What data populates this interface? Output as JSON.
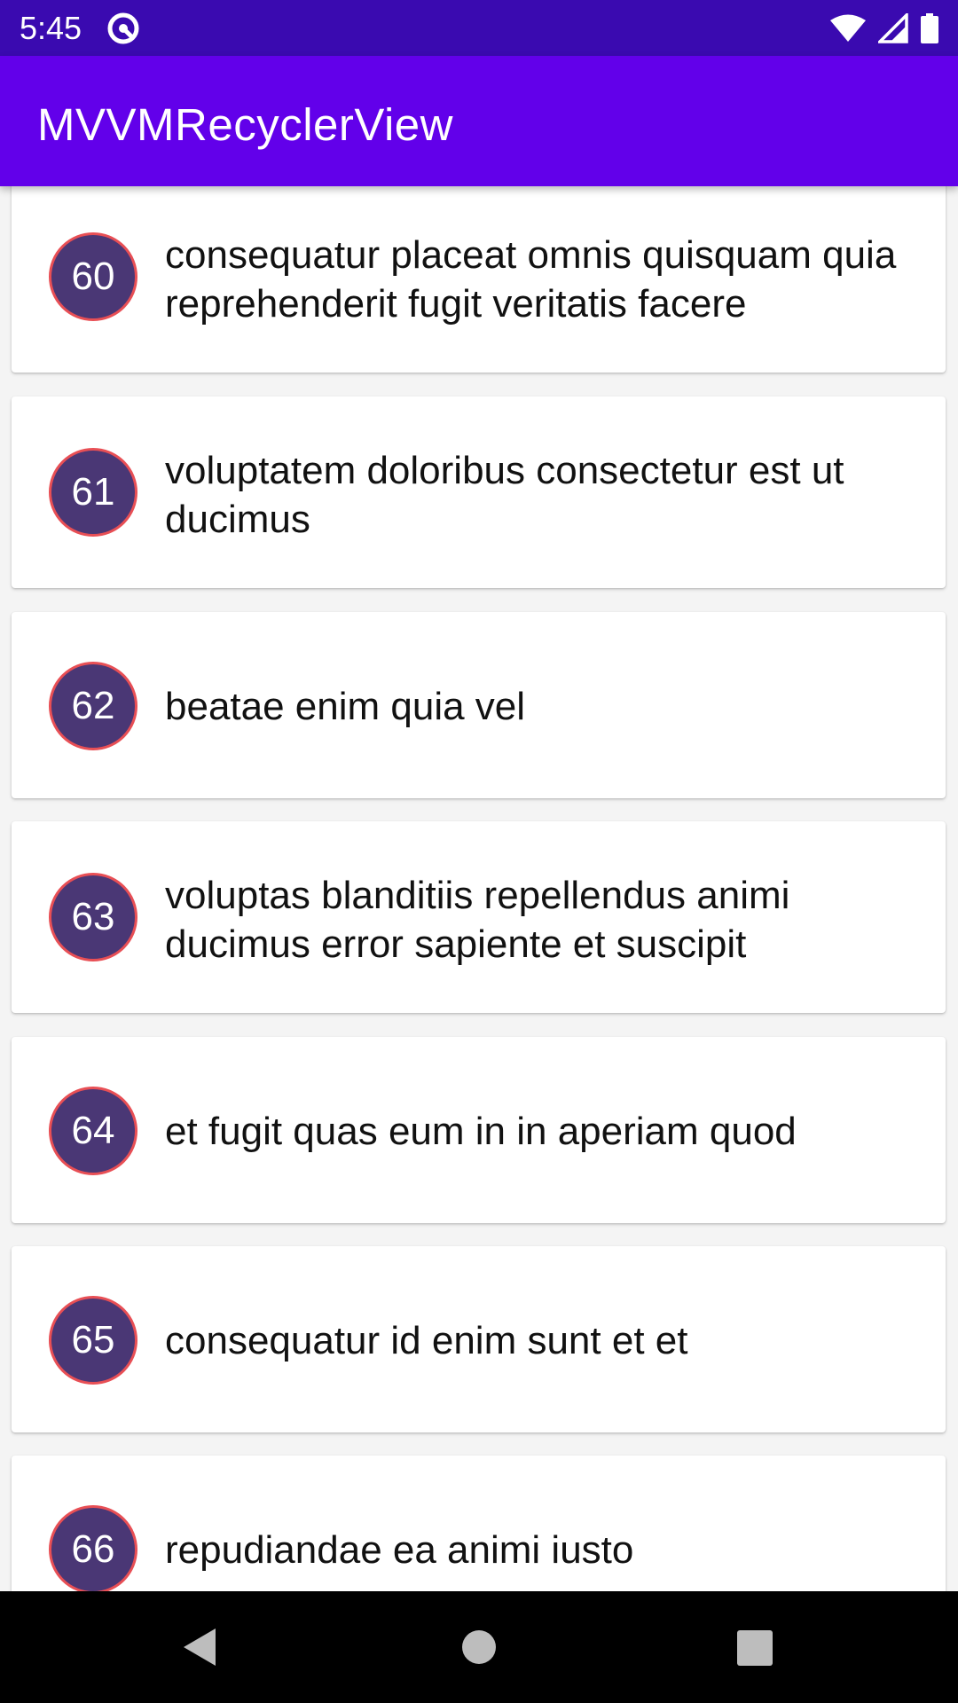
{
  "status_bar": {
    "time": "5:45",
    "icons": [
      "privacy-icon",
      "wifi-icon",
      "signal-icon",
      "battery-icon"
    ]
  },
  "app_bar": {
    "title": "MVVMRecyclerView"
  },
  "list": {
    "items": [
      {
        "id": "60",
        "text": "consequatur placeat omnis quisquam quia reprehenderit fugit veritatis facere"
      },
      {
        "id": "61",
        "text": "voluptatem doloribus consectetur est ut ducimus"
      },
      {
        "id": "62",
        "text": "beatae enim quia vel"
      },
      {
        "id": "63",
        "text": "voluptas blanditiis repellendus animi ducimus error sapiente et suscipit"
      },
      {
        "id": "64",
        "text": "et fugit quas eum in in aperiam quod"
      },
      {
        "id": "65",
        "text": "consequatur id enim sunt et et"
      },
      {
        "id": "66",
        "text": "repudiandae ea animi iusto"
      }
    ]
  },
  "nav_bar": {
    "icons": [
      "back-icon",
      "home-icon",
      "recents-icon"
    ]
  },
  "colors": {
    "status_bar": "#3a0ab0",
    "app_bar": "#6200ea",
    "badge_fill": "#4a3775",
    "badge_border": "#e84f55",
    "background": "#f4f4f4"
  }
}
